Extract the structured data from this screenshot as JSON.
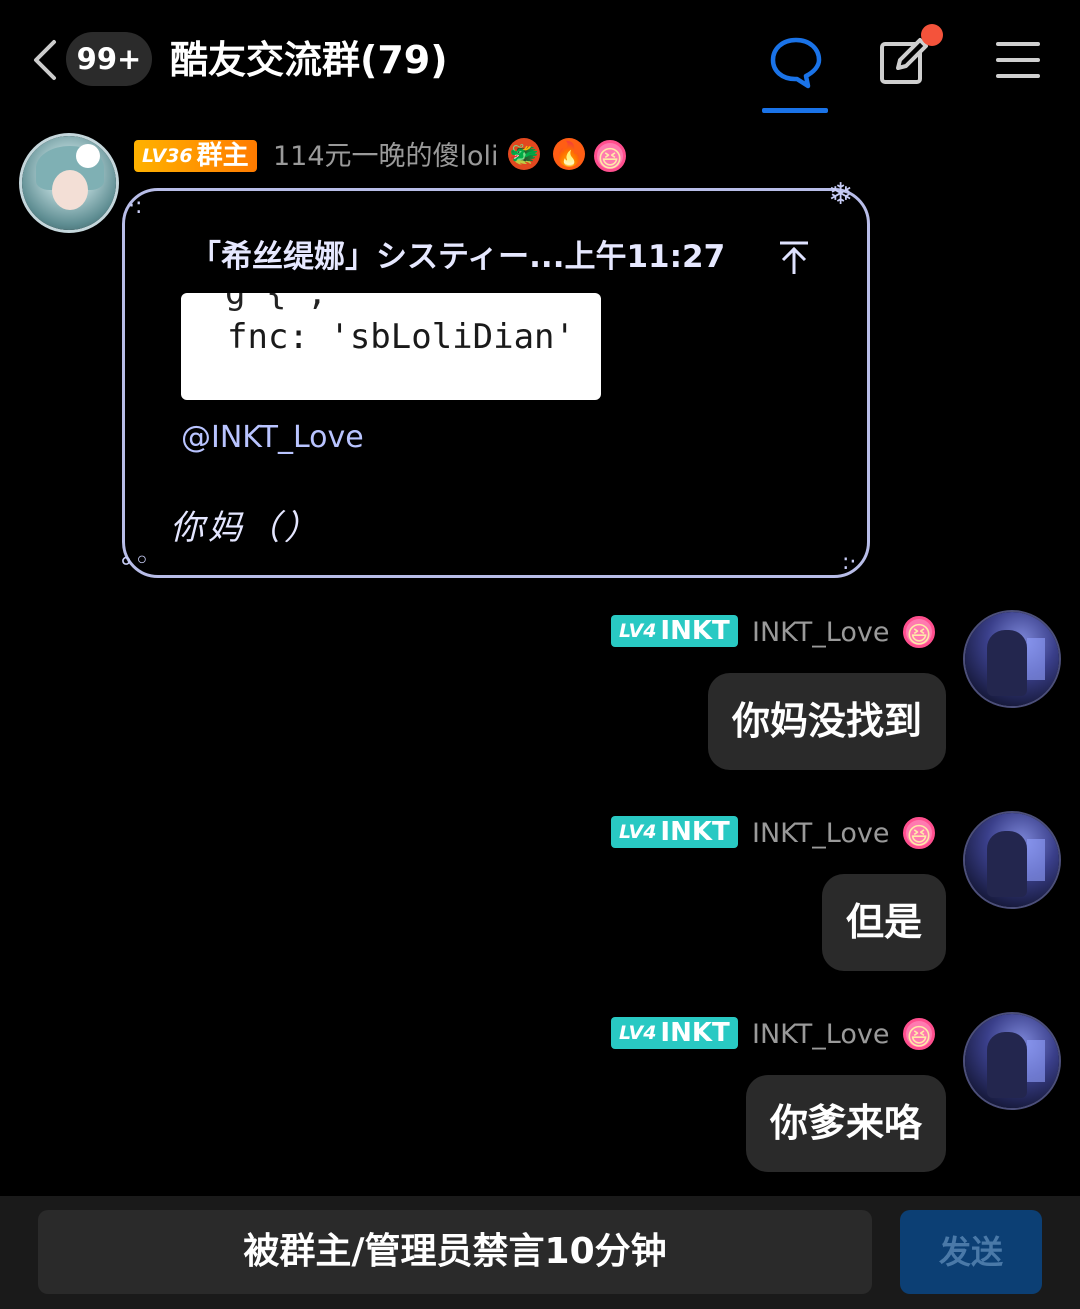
{
  "header": {
    "unread_count": "99+",
    "group_title": "酷友交流群(79)"
  },
  "messages": [
    {
      "sender": {
        "level": "LV36",
        "role": "群主",
        "name": "114元一晚的傻loli"
      },
      "quote": {
        "header": "「希丝缇娜」システィー...上午11:27",
        "code_line": "fnc: 'sbLoliDian'",
        "mention": "@INKT_Love",
        "text": "你妈（）"
      }
    },
    {
      "sender": {
        "level": "LV4",
        "tag": "INKT",
        "name": "INKT_Love"
      },
      "text": "你妈没找到"
    },
    {
      "sender": {
        "level": "LV4",
        "tag": "INKT",
        "name": "INKT_Love"
      },
      "text": "但是"
    },
    {
      "sender": {
        "level": "LV4",
        "tag": "INKT",
        "name": "INKT_Love"
      },
      "text": "你爹来咯"
    }
  ],
  "input": {
    "muted_notice": "被群主/管理员禁言10分钟",
    "send_label": "发送"
  },
  "icons": {
    "back": "chevron-left-icon",
    "chat": "chat-bubble-icon",
    "edit": "edit-icon",
    "menu": "menu-icon",
    "quote_arrow": "arrow-up-icon"
  },
  "colors": {
    "accent": "#1a73e8",
    "owner_badge": "#ff9a00",
    "user_badge": "#29c9c3",
    "notify_dot": "#f4533b",
    "send_disabled": "#0c3f74"
  }
}
